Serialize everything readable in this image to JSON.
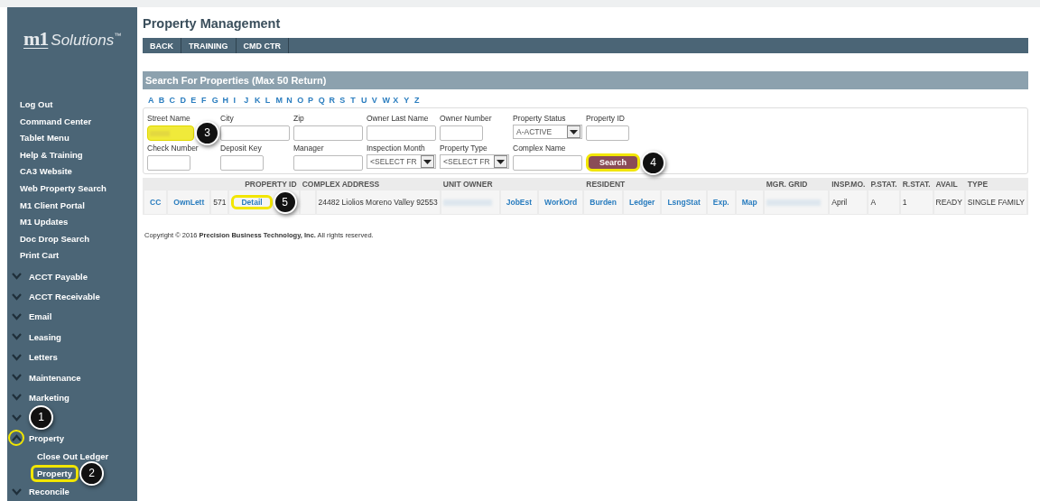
{
  "sidebar": {
    "logo": {
      "mark": "m1",
      "text": "Solutions",
      "tm": "™"
    },
    "links": [
      {
        "label": "Log Out"
      },
      {
        "label": "Command Center"
      },
      {
        "label": "Tablet Menu"
      },
      {
        "label": "Help & Training"
      },
      {
        "label": "CA3 Website"
      },
      {
        "label": "Web Property Search"
      },
      {
        "label": "M1 Client Portal"
      },
      {
        "label": "M1 Updates"
      },
      {
        "label": "Doc Drop Search"
      },
      {
        "label": "Print Cart"
      }
    ],
    "groups": [
      {
        "label": "ACCT Payable",
        "expanded": false
      },
      {
        "label": "ACCT Receivable",
        "expanded": false
      },
      {
        "label": "Email",
        "expanded": false
      },
      {
        "label": "Leasing",
        "expanded": false
      },
      {
        "label": "Letters",
        "expanded": false
      },
      {
        "label": "Maintenance",
        "expanded": false
      },
      {
        "label": "Marketing",
        "expanded": false
      },
      {
        "expanded": false,
        "callout": "1"
      },
      {
        "label": "Property",
        "expanded": true,
        "highlighted": true,
        "children": [
          {
            "label": "Close Out Ledger",
            "highlighted": false
          },
          {
            "label": "Property",
            "highlighted": true,
            "callout": "2"
          }
        ]
      },
      {
        "label": "Reconcile",
        "expanded": false
      }
    ]
  },
  "page": {
    "title": "Property Management",
    "nav": [
      "BACK",
      "TRAINING",
      "CMD CTR"
    ]
  },
  "search": {
    "title": "Search For Properties (Max 50 Return)",
    "letters": [
      "A",
      "B",
      "C",
      "D",
      "E",
      "F",
      "G",
      "H",
      "I",
      "J",
      "K",
      "L",
      "M",
      "N",
      "O",
      "P",
      "Q",
      "R",
      "S",
      "T",
      "U",
      "V",
      "W",
      "X",
      "Y",
      "Z"
    ],
    "rows": [
      [
        {
          "kind": "text",
          "label": "Street Name",
          "blurred": true,
          "highlighted": true,
          "callout": "3"
        },
        {
          "kind": "text",
          "label": "City"
        },
        {
          "kind": "text",
          "label": "Zip"
        },
        {
          "kind": "text",
          "label": "Owner Last Name"
        },
        {
          "kind": "short_text",
          "label": "Owner Number"
        },
        {
          "kind": "select",
          "label": "Property Status",
          "value": "A-ACTIVE"
        },
        {
          "kind": "short_text",
          "label": "Property ID"
        }
      ],
      [
        {
          "kind": "short_text",
          "label": "Check Number"
        },
        {
          "kind": "short_text",
          "label": "Deposit Key"
        },
        {
          "kind": "text",
          "label": "Manager"
        },
        {
          "kind": "select",
          "label": "Inspection Month",
          "value": "<SELECT FR"
        },
        {
          "kind": "select",
          "label": "Property Type",
          "value": "<SELECT FR"
        },
        {
          "kind": "text",
          "label": "Complex Name"
        },
        {
          "kind": "button",
          "label": "Search",
          "highlighted": true,
          "callout": "4"
        }
      ]
    ]
  },
  "results": {
    "header": [
      {
        "kind": "blank"
      },
      {
        "kind": "label",
        "label": "PROPERTY ID"
      },
      {
        "kind": "label",
        "label": "COMPLEX ADDRESS"
      },
      {
        "kind": "label",
        "label": "UNIT OWNER"
      },
      {
        "kind": "label",
        "label": "RESIDENT"
      },
      {
        "kind": "label",
        "label": "MGR. GRID"
      },
      {
        "kind": "label",
        "label": "INSP.MO."
      },
      {
        "kind": "label",
        "label": "P.STAT."
      },
      {
        "kind": "label",
        "label": "R.STAT."
      },
      {
        "kind": "label",
        "label": "AVAIL"
      },
      {
        "kind": "label",
        "label": "TYPE"
      }
    ],
    "rows": [
      [
        {
          "kind": "link",
          "text": "CC"
        },
        {
          "kind": "link",
          "text": "OwnLett"
        },
        {
          "kind": "text",
          "text": "571"
        },
        {
          "kind": "link",
          "text": "Detail",
          "highlighted": true,
          "callout": "5"
        },
        {
          "kind": "empty"
        },
        {
          "kind": "text",
          "text": "24482 Liolios Moreno Valley 92553"
        },
        {
          "kind": "blurred"
        },
        {
          "kind": "link",
          "text": "JobEst"
        },
        {
          "kind": "link",
          "text": "WorkOrd"
        },
        {
          "kind": "link",
          "text": "Burden"
        },
        {
          "kind": "link",
          "text": "Ledger"
        },
        {
          "kind": "link",
          "text": "LsngStat"
        },
        {
          "kind": "link",
          "text": "Exp."
        },
        {
          "kind": "link",
          "text": "Map"
        },
        {
          "kind": "blurred"
        },
        {
          "kind": "text",
          "text": "April"
        },
        {
          "kind": "text",
          "text": "A"
        },
        {
          "kind": "text",
          "text": "1"
        },
        {
          "kind": "text",
          "text": "READY"
        },
        {
          "kind": "text",
          "text": "SINGLE FAMILY"
        }
      ]
    ]
  },
  "footer": {
    "copyright": "Copyright © 2016 **Precision Business Technology, Inc.**   All rights reserved."
  }
}
